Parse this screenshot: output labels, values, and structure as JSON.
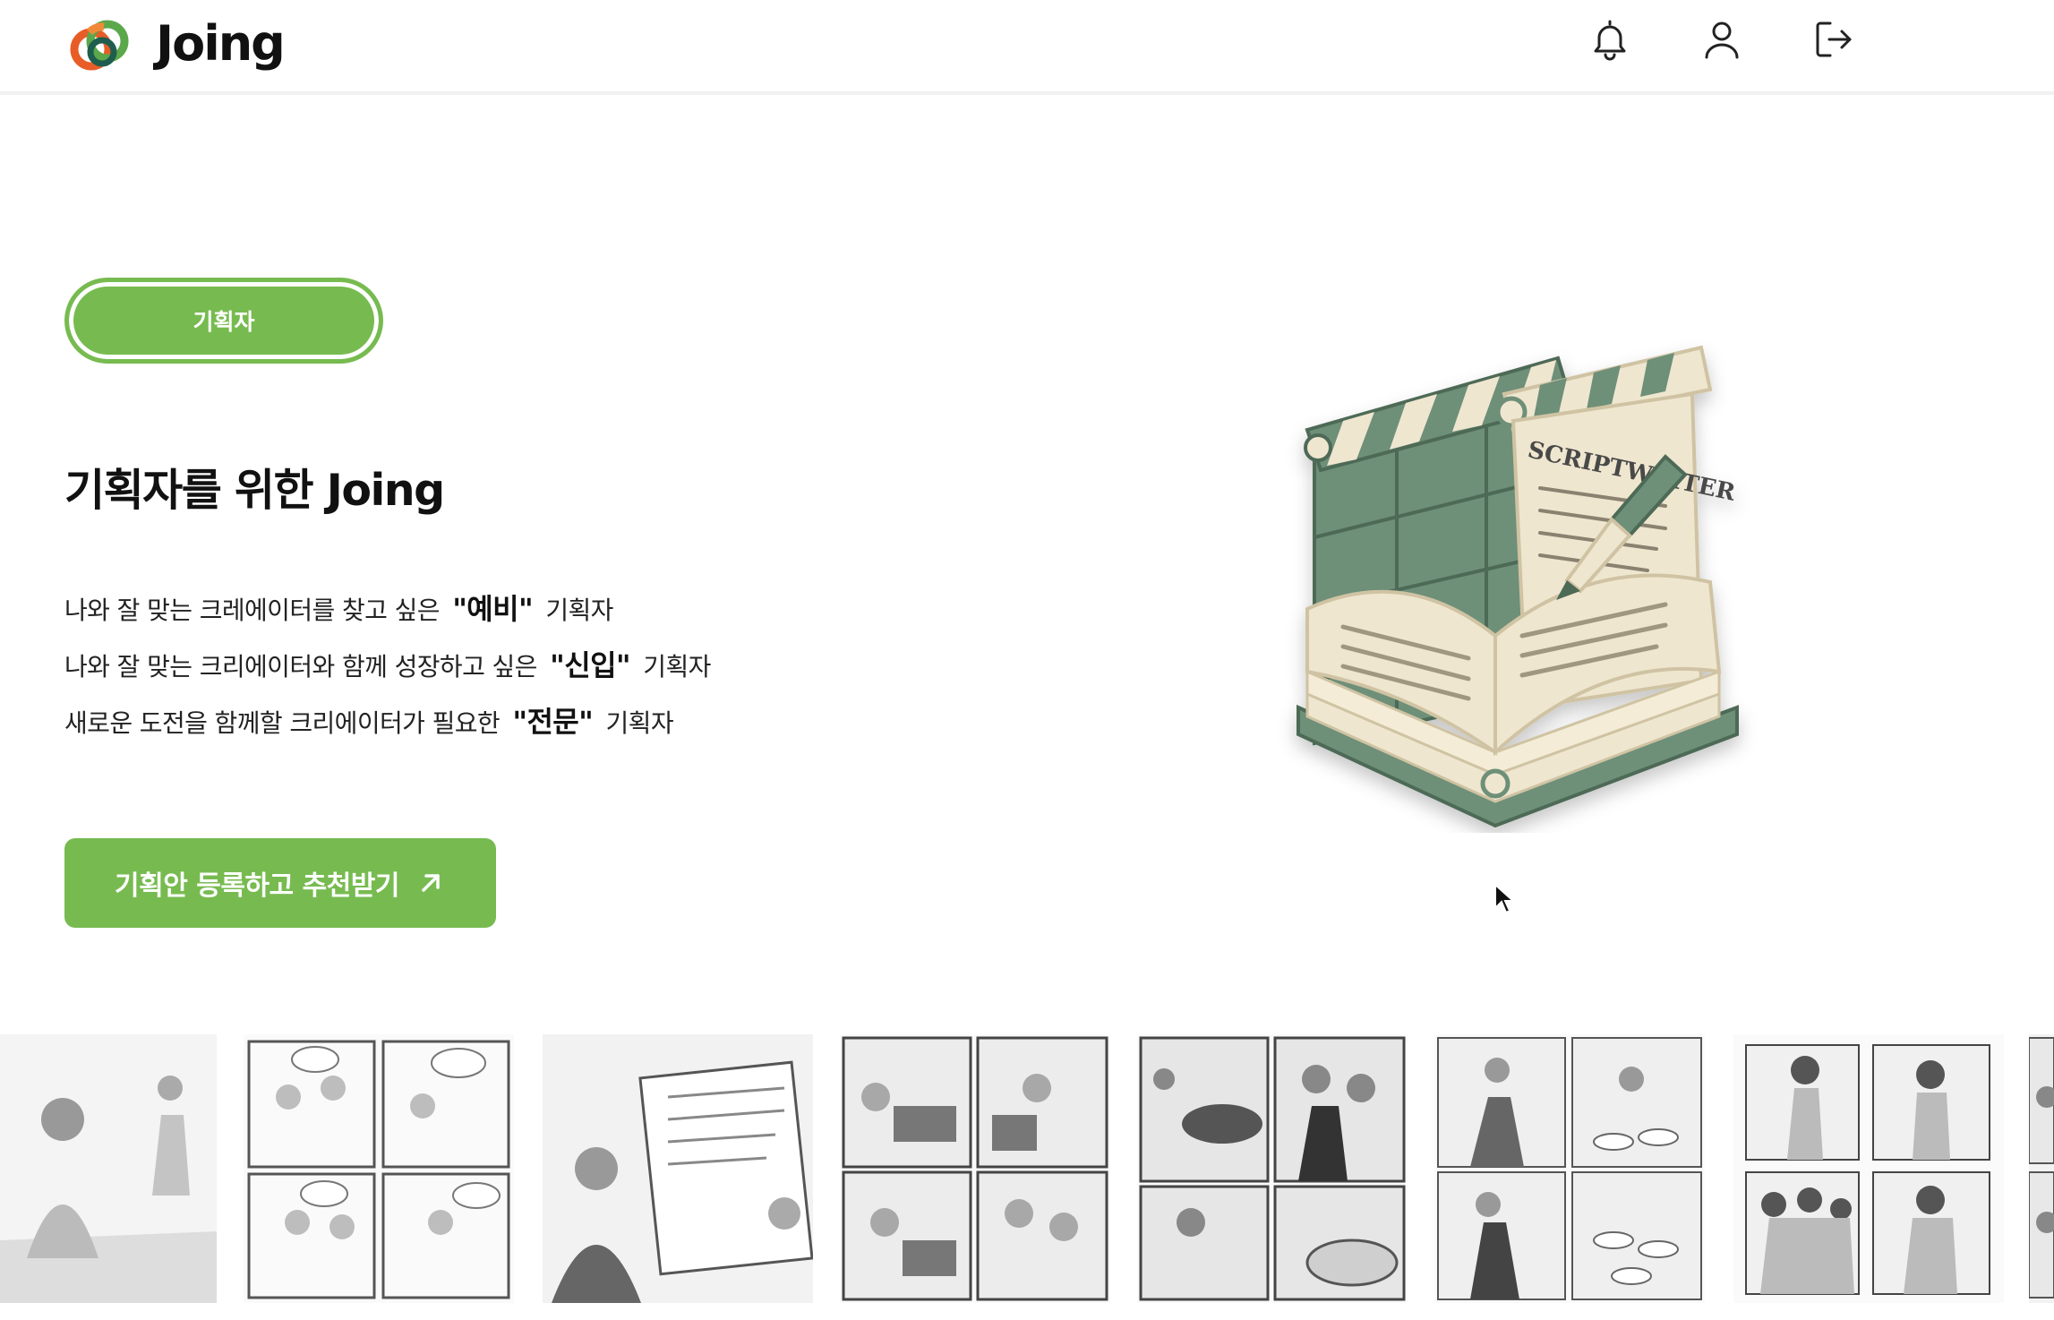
{
  "header": {
    "brand": "Joing",
    "icons": [
      "bell-icon",
      "user-icon",
      "logout-icon"
    ]
  },
  "hero": {
    "role_label": "기획자",
    "title": "기획자를 위한 Joing",
    "lines": [
      {
        "pre": "나와 잘 맞는 크레에이터를 찾고 싶은 ",
        "em": "\"예비\"",
        "post": " 기획자"
      },
      {
        "pre": "나와 잘 맞는 크리에이터와 함께 성장하고 싶은 ",
        "em": "\"신입\"",
        "post": " 기획자"
      },
      {
        "pre": "새로운 도전을 함께할 크리에이터가 필요한 ",
        "em": "\"전문\"",
        "post": " 기획자"
      }
    ],
    "cta_label": "기획안 등록하고 추천받기"
  },
  "illustration": {
    "label": "SCRIPTWRITER"
  },
  "colors": {
    "accent": "#77bb50",
    "text": "#111111",
    "muted_green": "#6f9179",
    "cream": "#efe6cf"
  }
}
